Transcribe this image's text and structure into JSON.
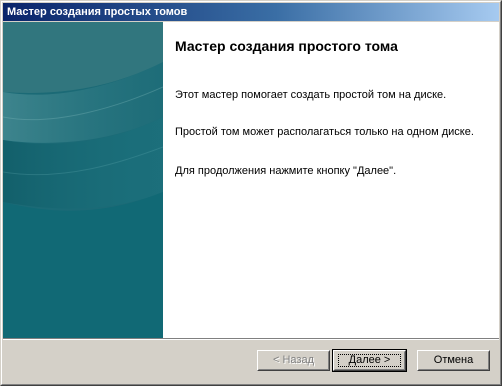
{
  "window": {
    "title": "Мастер создания простых томов"
  },
  "content": {
    "heading": "Мастер создания простого тома",
    "paragraphs": [
      "Этот мастер помогает создать простой том на диске.",
      "Простой том может располагаться только на одном диске.",
      "Для продолжения нажмите кнопку \"Далее\"."
    ]
  },
  "buttons": {
    "back_label": "< Назад",
    "next_label": "Далее >",
    "cancel_label": "Отмена"
  },
  "colors": {
    "titlebar_start": "#0a246a",
    "titlebar_end": "#a6caf0",
    "side_panel": "#136a78",
    "window_face": "#d4d0c8"
  }
}
